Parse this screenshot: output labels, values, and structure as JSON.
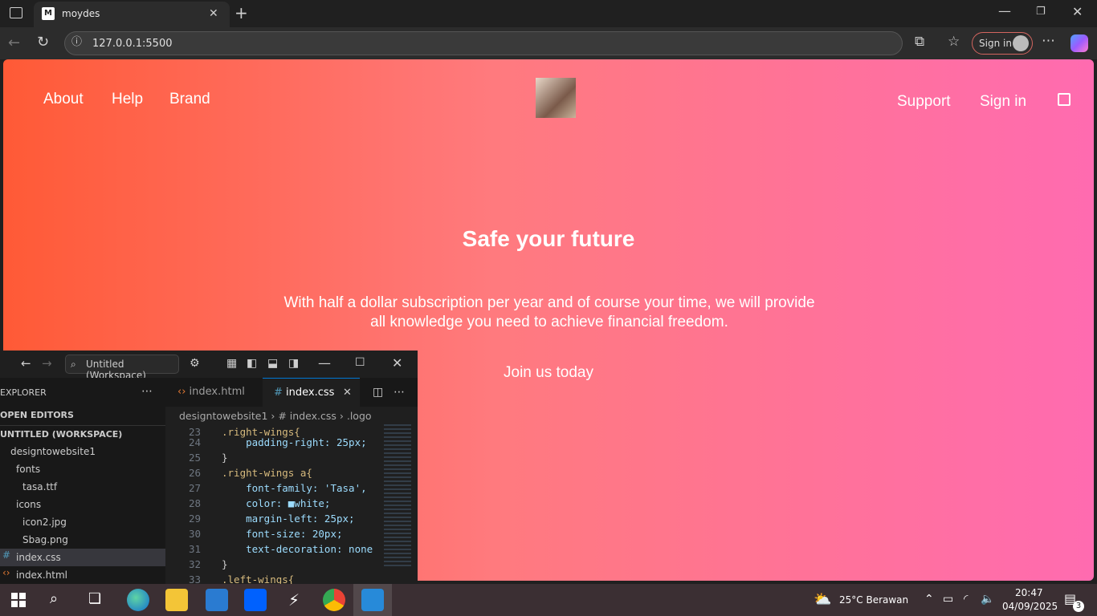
{
  "browser": {
    "tab_title": "moydes",
    "address": "127.0.0.1:5500",
    "signin_label": "Sign in"
  },
  "page": {
    "nav_left": [
      "About",
      "Help",
      "Brand"
    ],
    "nav_right": [
      "Support",
      "Sign in"
    ],
    "hero_title": "Safe your future",
    "hero_subtitle": "With half a dollar subscription per year and of course your time, we will provide all knowledge you need to achieve financial freedom.",
    "cta": "Join us today"
  },
  "vscode": {
    "search_label": "Untitled (Workspace)",
    "explorer_label": "EXPLORER",
    "open_editors": "OPEN EDITORS",
    "workspace": "UNTITLED (WORKSPACE)",
    "tree": [
      "designtowebsite1",
      "fonts",
      "tasa.ttf",
      "icons",
      "icon2.jpg",
      "Sbag.png",
      "index.css",
      "index.html"
    ],
    "tabs": [
      "index.html",
      "index.css"
    ],
    "breadcrumb": [
      "designtowebsite1",
      "# index.css",
      ".logo"
    ],
    "code": [
      {
        "n": "23",
        "t": ".right-wings{"
      },
      {
        "n": "24",
        "t": "    padding-right: 25px;"
      },
      {
        "n": "25",
        "t": "}"
      },
      {
        "n": "26",
        "t": ".right-wings a{"
      },
      {
        "n": "27",
        "t": "    font-family: 'Tasa',"
      },
      {
        "n": "28",
        "t": "    color: ■white;"
      },
      {
        "n": "29",
        "t": "    margin-left: 25px;"
      },
      {
        "n": "30",
        "t": "    font-size: 20px;"
      },
      {
        "n": "31",
        "t": "    text-decoration: none"
      },
      {
        "n": "32",
        "t": "}"
      },
      {
        "n": "33",
        "t": ".left-wings{"
      }
    ]
  },
  "taskbar": {
    "weather": "25°C Berawan",
    "time": "20:47",
    "date": "04/09/2025",
    "notifications": "3"
  },
  "colors": {
    "accent_start": "#ff5a36",
    "accent_end": "#ff6bb0"
  }
}
